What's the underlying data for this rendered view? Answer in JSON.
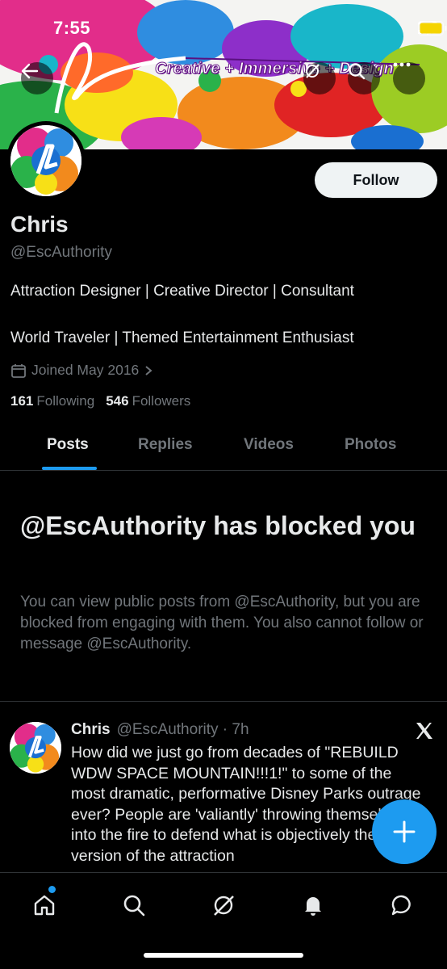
{
  "status_bar": {
    "time": "7:55"
  },
  "banner": {
    "tagline": "Creative + Immersive + Design"
  },
  "header": {
    "back_icon": "back-arrow-icon",
    "grok_icon": "grok-icon",
    "search_icon": "search-icon",
    "more_icon": "more-icon"
  },
  "profile": {
    "follow_label": "Follow",
    "name": "Chris",
    "handle": "@EscAuthority",
    "bio_line1": "Attraction Designer | Creative Director | Consultant",
    "bio_line2": "World Traveler | Themed Entertainment Enthusiast",
    "joined": "Joined May 2016",
    "following_count": "161",
    "following_label": "Following",
    "followers_count": "546",
    "followers_label": "Followers"
  },
  "tabs": [
    {
      "label": "Posts",
      "active": true
    },
    {
      "label": "Replies",
      "active": false
    },
    {
      "label": "Videos",
      "active": false
    },
    {
      "label": "Photos",
      "active": false
    }
  ],
  "blocked": {
    "title": "@EscAuthority has blocked you",
    "body": "You can view public posts from @EscAuthority, but you are blocked from engaging with them. You also cannot follow or message @EscAuthority."
  },
  "post": {
    "author": "Chris",
    "handle_time": "@EscAuthority · 7h",
    "text": "How did we just go from decades of \"REBUILD WDW SPACE MOUNTAIN!!!1!\" to some of the most dramatic, performative Disney Parks outrage ever? People are 'valiantly' throwing themselves into the fire to defend what is objectively the worst version of the attraction"
  },
  "bottom_nav": [
    "home-icon",
    "search-icon",
    "grok-icon",
    "notifications-icon",
    "messages-icon"
  ],
  "colors": {
    "accent": "#1d9bf0",
    "background": "#000000",
    "muted": "#71767b"
  }
}
